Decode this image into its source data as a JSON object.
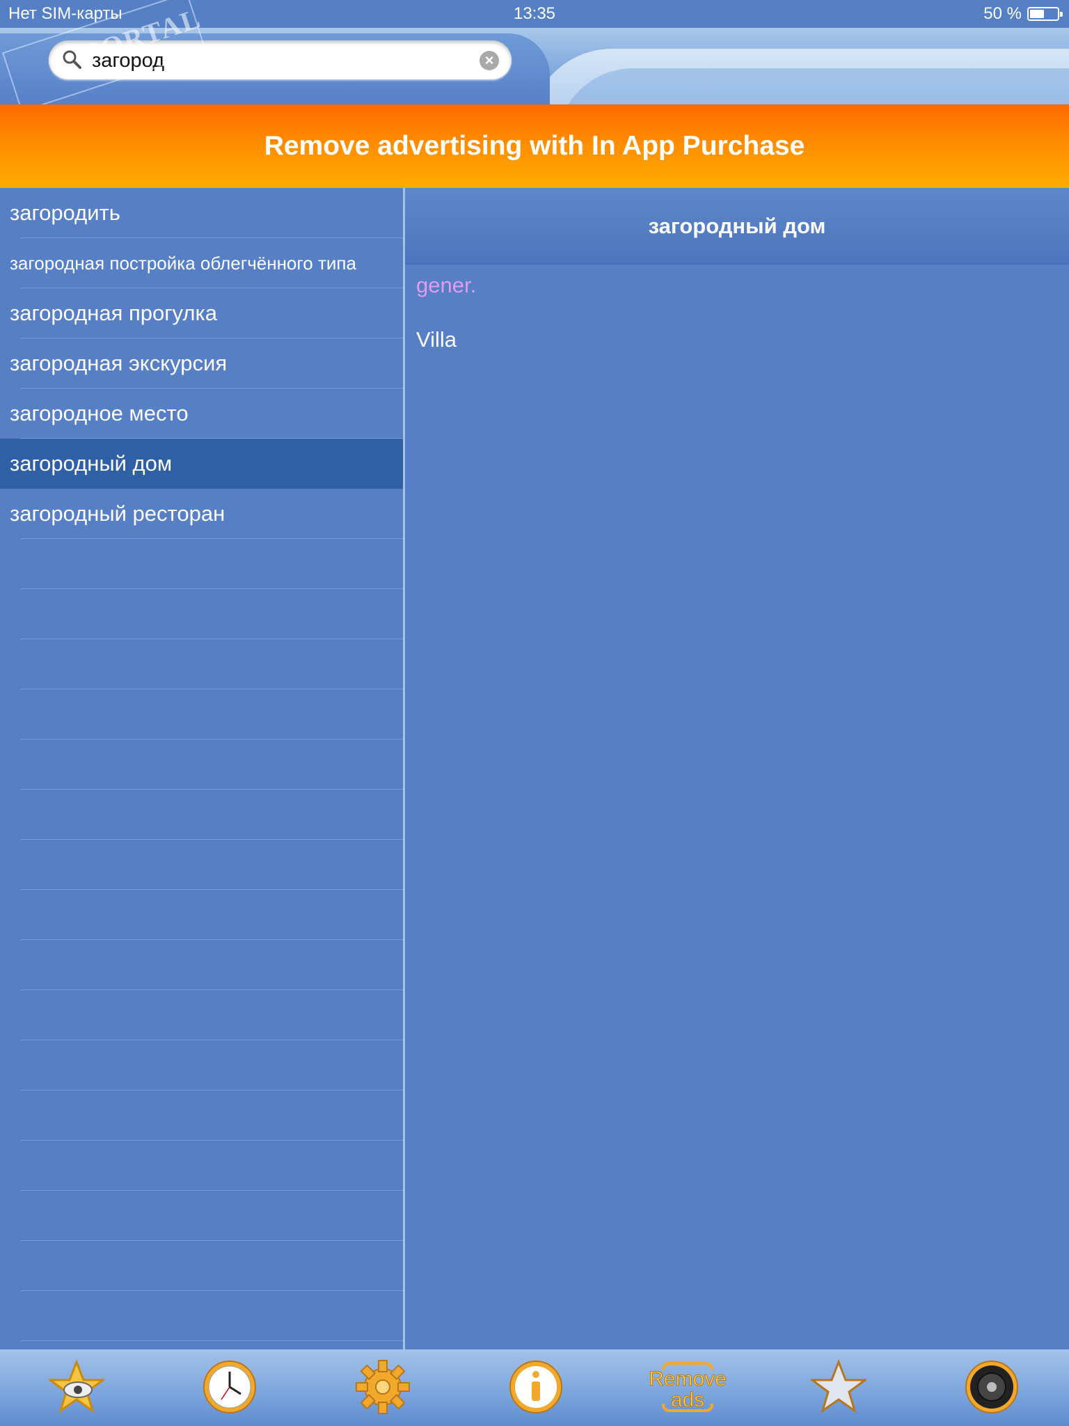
{
  "status_bar": {
    "carrier": "Нет SIM-карты",
    "time": "13:35",
    "battery": "50 %"
  },
  "search": {
    "query": "загород"
  },
  "watermark": {
    "text": "PORTAL"
  },
  "ad_banner": {
    "text": "Remove advertising with In App Purchase"
  },
  "results": [
    {
      "label": "загородить"
    },
    {
      "label": "загородная постройка облегчённого типа"
    },
    {
      "label": "загородная прогулка"
    },
    {
      "label": "загородная экскурсия"
    },
    {
      "label": "загородное место"
    },
    {
      "label": "загородный дом"
    },
    {
      "label": "загородный ресторан"
    }
  ],
  "selected_index": 5,
  "detail": {
    "headword": "загородный дом",
    "part_of_speech": "gener.",
    "translation": "Villa"
  },
  "tabbar": {
    "items": [
      {
        "icon": "star-eye-icon"
      },
      {
        "icon": "clock-icon"
      },
      {
        "icon": "gear-icon"
      },
      {
        "icon": "info-icon"
      },
      {
        "icon": "remove-ads-icon",
        "label_line1": "Remove",
        "label_line2": "ads"
      },
      {
        "icon": "star-icon"
      },
      {
        "icon": "speaker-icon"
      }
    ]
  },
  "colors": {
    "background": "#567fc5",
    "selected_row": "#2f5fa4",
    "part_of_speech": "#e39bec",
    "banner_top": "#ff6a00",
    "banner_bottom": "#ffac00"
  }
}
